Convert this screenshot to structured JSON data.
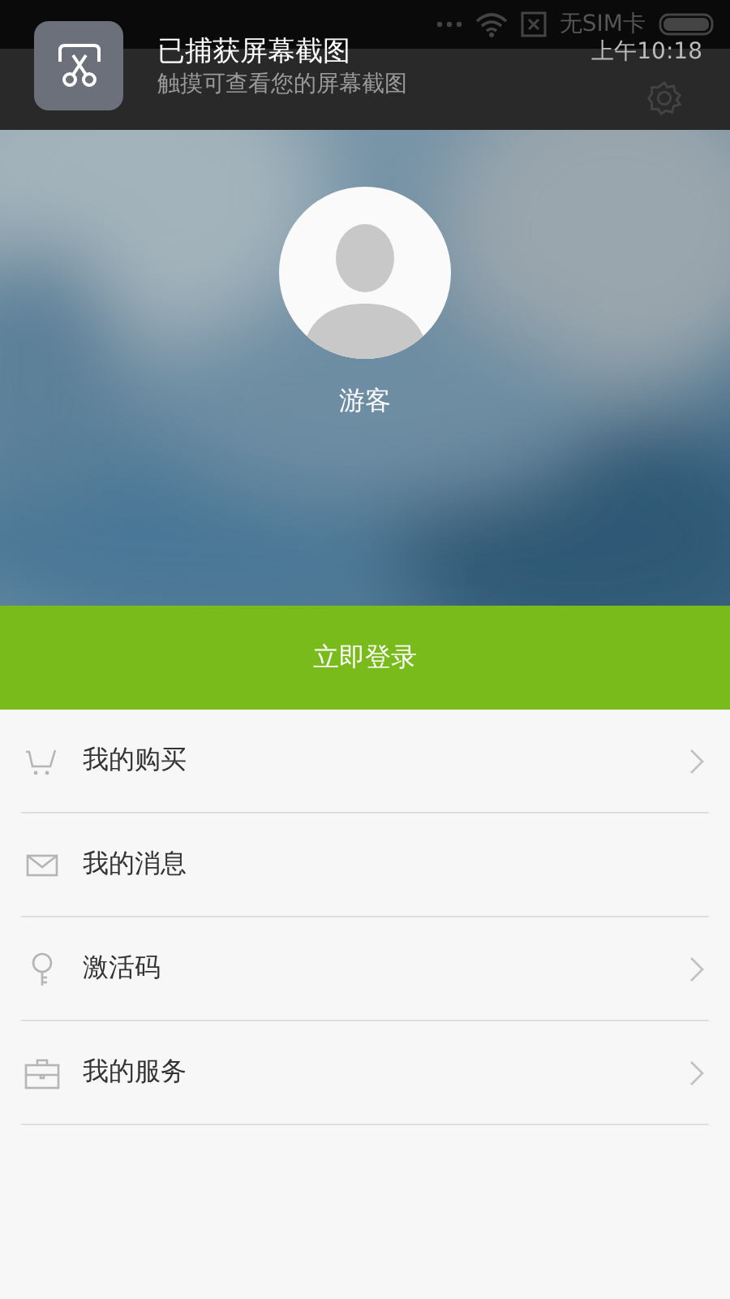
{
  "status_bar": {
    "carrier": "无SIM卡"
  },
  "notification": {
    "title": "已捕获屏幕截图",
    "text": "触摸可查看您的屏幕截图",
    "time": "上午10:18"
  },
  "profile": {
    "name": "游客"
  },
  "login_button": {
    "label": "立即登录"
  },
  "menu": [
    {
      "label": "我的购买",
      "kind": "cart",
      "has_arrow": true
    },
    {
      "label": "我的消息",
      "kind": "mail",
      "has_arrow": false
    },
    {
      "label": "激活码",
      "kind": "key",
      "has_arrow": true
    },
    {
      "label": "我的服务",
      "kind": "briefcase",
      "has_arrow": true
    }
  ]
}
